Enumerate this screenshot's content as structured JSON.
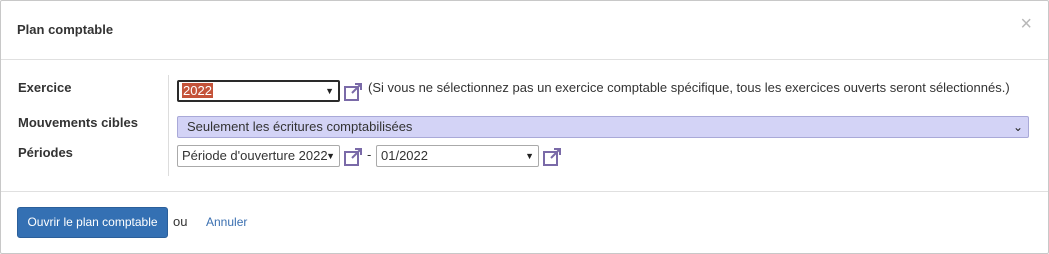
{
  "dialog": {
    "title": "Plan comptable",
    "close_glyph": "×"
  },
  "form": {
    "exercice": {
      "label": "Exercice",
      "value": "2022",
      "hint": "(Si vous ne sélectionnez pas un exercice comptable spécifique, tous les exercices ouverts seront sélectionnés.)"
    },
    "mouvements": {
      "label": "Mouvements cibles",
      "value": "Seulement les écritures comptabilisées"
    },
    "periodes": {
      "label": "Périodes",
      "from_value": "Période d'ouverture 2022",
      "separator": "-",
      "to_value": "01/2022"
    }
  },
  "footer": {
    "primary_label": "Ouvrir le plan comptable",
    "or_text": "ou",
    "cancel_label": "Annuler"
  },
  "icons": {
    "external": "external-link-icon",
    "dropdown": "dropdown-arrow-icon",
    "close": "close-icon"
  },
  "colors": {
    "primary": "#3470b3",
    "link": "#3a6fb0",
    "highlight": "#c4533a",
    "select_highlight_bg": "#d3d3f6",
    "icon": "#7a6aa8"
  }
}
